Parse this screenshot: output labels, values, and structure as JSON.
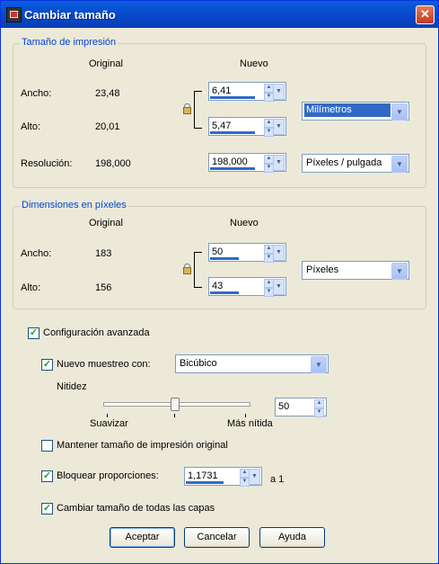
{
  "window": {
    "title": "Cambiar tamaño",
    "close_label": "✕"
  },
  "print_size": {
    "legend": "Tamaño de impresión",
    "col_original": "Original",
    "col_new": "Nuevo",
    "width_label": "Ancho:",
    "height_label": "Alto:",
    "resolution_label": "Resolución:",
    "width_original": "23,48",
    "height_original": "20,01",
    "resolution_original": "198,000",
    "width_new": "6,41",
    "height_new": "5,47",
    "resolution_new": "198,000",
    "unit": "Milímetros",
    "res_unit": "Píxeles / pulgada"
  },
  "pixel_dims": {
    "legend": "Dimensiones en píxeles",
    "col_original": "Original",
    "col_new": "Nuevo",
    "width_label": "Ancho:",
    "height_label": "Alto:",
    "width_original": "183",
    "height_original": "156",
    "width_new": "50",
    "height_new": "43",
    "unit": "Píxeles"
  },
  "advanced": {
    "label": "Configuración avanzada",
    "checked": true,
    "resample_label": "Nuevo muestreo con:",
    "resample_checked": true,
    "resample_method": "Bicúbico",
    "sharpness_label": "Nitidez",
    "soften_label": "Suavizar",
    "sharper_label": "Más nítida",
    "sharpness_value": "50",
    "keep_print_label": "Mantener tamaño de impresión original",
    "keep_print_checked": false,
    "lock_ratio_label": "Bloquear proporciones:",
    "lock_ratio_checked": true,
    "ratio_value": "1,1731",
    "ratio_suffix": "a 1",
    "all_layers_label": "Cambiar tamaño de todas las capas",
    "all_layers_checked": true
  },
  "buttons": {
    "ok": "Aceptar",
    "cancel": "Cancelar",
    "help": "Ayuda"
  },
  "colors": {
    "accent": "#0046d5",
    "selection": "#316ac5",
    "titlebar": "#0747c9"
  }
}
